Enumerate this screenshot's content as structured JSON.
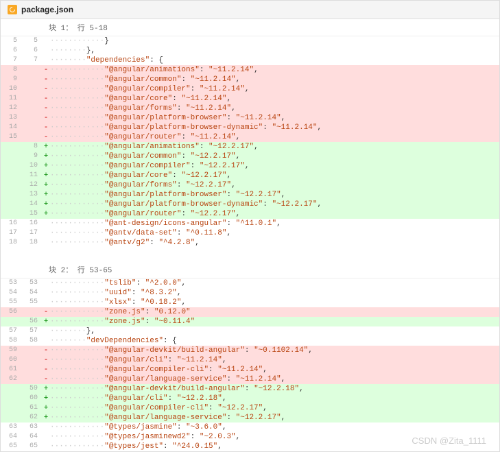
{
  "filename": "package.json",
  "watermark": "CSDN @Zita_1111",
  "hunks": [
    {
      "header": "块 1： 行 5-18",
      "lines": [
        {
          "ol": "5",
          "nl": "5",
          "t": "ctx",
          "ind": 3,
          "txt": "}"
        },
        {
          "ol": "6",
          "nl": "6",
          "t": "ctx",
          "ind": 2,
          "txt": "},"
        },
        {
          "ol": "7",
          "nl": "7",
          "t": "ctx",
          "ind": 2,
          "k": "dependencies",
          "post": ": {"
        },
        {
          "ol": "8",
          "nl": "",
          "t": "del",
          "ind": 3,
          "k": "@angular/animations",
          "v": "~11.2.14",
          "c": true
        },
        {
          "ol": "9",
          "nl": "",
          "t": "del",
          "ind": 3,
          "k": "@angular/common",
          "v": "~11.2.14",
          "c": true
        },
        {
          "ol": "10",
          "nl": "",
          "t": "del",
          "ind": 3,
          "k": "@angular/compiler",
          "v": "~11.2.14",
          "c": true
        },
        {
          "ol": "11",
          "nl": "",
          "t": "del",
          "ind": 3,
          "k": "@angular/core",
          "v": "~11.2.14",
          "c": true
        },
        {
          "ol": "12",
          "nl": "",
          "t": "del",
          "ind": 3,
          "k": "@angular/forms",
          "v": "~11.2.14",
          "c": true
        },
        {
          "ol": "13",
          "nl": "",
          "t": "del",
          "ind": 3,
          "k": "@angular/platform-browser",
          "v": "~11.2.14",
          "c": true
        },
        {
          "ol": "14",
          "nl": "",
          "t": "del",
          "ind": 3,
          "k": "@angular/platform-browser-dynamic",
          "v": "~11.2.14",
          "c": true
        },
        {
          "ol": "15",
          "nl": "",
          "t": "del",
          "ind": 3,
          "k": "@angular/router",
          "v": "~11.2.14",
          "c": true
        },
        {
          "ol": "",
          "nl": "8",
          "t": "add",
          "ind": 3,
          "k": "@angular/animations",
          "v": "~12.2.17",
          "c": true
        },
        {
          "ol": "",
          "nl": "9",
          "t": "add",
          "ind": 3,
          "k": "@angular/common",
          "v": "~12.2.17",
          "c": true
        },
        {
          "ol": "",
          "nl": "10",
          "t": "add",
          "ind": 3,
          "k": "@angular/compiler",
          "v": "~12.2.17",
          "c": true
        },
        {
          "ol": "",
          "nl": "11",
          "t": "add",
          "ind": 3,
          "k": "@angular/core",
          "v": "~12.2.17",
          "c": true
        },
        {
          "ol": "",
          "nl": "12",
          "t": "add",
          "ind": 3,
          "k": "@angular/forms",
          "v": "~12.2.17",
          "c": true
        },
        {
          "ol": "",
          "nl": "13",
          "t": "add",
          "ind": 3,
          "k": "@angular/platform-browser",
          "v": "~12.2.17",
          "c": true
        },
        {
          "ol": "",
          "nl": "14",
          "t": "add",
          "ind": 3,
          "k": "@angular/platform-browser-dynamic",
          "v": "~12.2.17",
          "c": true
        },
        {
          "ol": "",
          "nl": "15",
          "t": "add",
          "ind": 3,
          "k": "@angular/router",
          "v": "~12.2.17",
          "c": true
        },
        {
          "ol": "16",
          "nl": "16",
          "t": "ctx",
          "ind": 3,
          "k": "@ant-design/icons-angular",
          "v": "^11.0.1",
          "c": true
        },
        {
          "ol": "17",
          "nl": "17",
          "t": "ctx",
          "ind": 3,
          "k": "@antv/data-set",
          "v": "^0.11.8",
          "c": true
        },
        {
          "ol": "18",
          "nl": "18",
          "t": "ctx",
          "ind": 3,
          "k": "@antv/g2",
          "v": "^4.2.8",
          "c": true
        }
      ]
    },
    {
      "header": "块 2： 行 53-65",
      "lines": [
        {
          "ol": "53",
          "nl": "53",
          "t": "ctx",
          "ind": 3,
          "k": "tslib",
          "v": "^2.0.0",
          "c": true
        },
        {
          "ol": "54",
          "nl": "54",
          "t": "ctx",
          "ind": 3,
          "k": "uuid",
          "v": "^8.3.2",
          "c": true
        },
        {
          "ol": "55",
          "nl": "55",
          "t": "ctx",
          "ind": 3,
          "k": "xlsx",
          "v": "^0.18.2",
          "c": true
        },
        {
          "ol": "56",
          "nl": "",
          "t": "del",
          "ind": 3,
          "k": "zone.js",
          "v": "0.12.0"
        },
        {
          "ol": "",
          "nl": "56",
          "t": "add",
          "ind": 3,
          "k": "zone.js",
          "v": "~0.11.4"
        },
        {
          "ol": "57",
          "nl": "57",
          "t": "ctx",
          "ind": 2,
          "txt": "},"
        },
        {
          "ol": "58",
          "nl": "58",
          "t": "ctx",
          "ind": 2,
          "k": "devDependencies",
          "post": ": {"
        },
        {
          "ol": "59",
          "nl": "",
          "t": "del",
          "ind": 3,
          "k": "@angular-devkit/build-angular",
          "v": "~0.1102.14",
          "c": true
        },
        {
          "ol": "60",
          "nl": "",
          "t": "del",
          "ind": 3,
          "k": "@angular/cli",
          "v": "~11.2.14",
          "c": true
        },
        {
          "ol": "61",
          "nl": "",
          "t": "del",
          "ind": 3,
          "k": "@angular/compiler-cli",
          "v": "~11.2.14",
          "c": true
        },
        {
          "ol": "62",
          "nl": "",
          "t": "del",
          "ind": 3,
          "k": "@angular/language-service",
          "v": "~11.2.14",
          "c": true
        },
        {
          "ol": "",
          "nl": "59",
          "t": "add",
          "ind": 3,
          "k": "@angular-devkit/build-angular",
          "v": "~12.2.18",
          "c": true
        },
        {
          "ol": "",
          "nl": "60",
          "t": "add",
          "ind": 3,
          "k": "@angular/cli",
          "v": "~12.2.18",
          "c": true
        },
        {
          "ol": "",
          "nl": "61",
          "t": "add",
          "ind": 3,
          "k": "@angular/compiler-cli",
          "v": "~12.2.17",
          "c": true
        },
        {
          "ol": "",
          "nl": "62",
          "t": "add",
          "ind": 3,
          "k": "@angular/language-service",
          "v": "~12.2.17",
          "c": true
        },
        {
          "ol": "63",
          "nl": "63",
          "t": "ctx",
          "ind": 3,
          "k": "@types/jasmine",
          "v": "~3.6.0",
          "c": true
        },
        {
          "ol": "64",
          "nl": "64",
          "t": "ctx",
          "ind": 3,
          "k": "@types/jasminewd2",
          "v": "~2.0.3",
          "c": true
        },
        {
          "ol": "65",
          "nl": "65",
          "t": "ctx",
          "ind": 3,
          "k": "@types/jest",
          "v": "^24.0.15",
          "c": true
        }
      ]
    }
  ]
}
